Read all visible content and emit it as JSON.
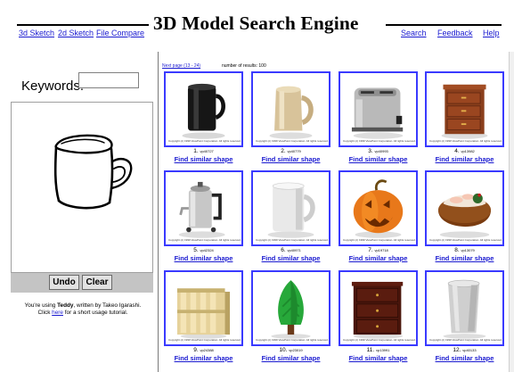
{
  "header": {
    "title": "3D Model Search Engine",
    "left_links": [
      "3d Sketch",
      "2d Sketch",
      "File Compare"
    ],
    "right_links": [
      "Search",
      "Feedback",
      "Help"
    ]
  },
  "search": {
    "keywords_label": "Keywords:",
    "keywords_value": ""
  },
  "sketch": {
    "undo_label": "Undo",
    "clear_label": "Clear",
    "note_prefix": "You're using ",
    "note_app": "Teddy",
    "note_mid": ", written by Takeo Igarashi.",
    "note_click": "Click ",
    "note_here": "here",
    "note_suffix": " for a short usage tutorial."
  },
  "results": {
    "next_page": "Next page (13 - 24)",
    "count_text": "number of results: 100",
    "similar_label": "Find similar shape",
    "copyright": "Copyright (c) 1999 ViewPoint Corporation. All rights reserved.",
    "items": [
      {
        "rank": "1.",
        "id": "vp40727",
        "icon": "black-mug-model"
      },
      {
        "rank": "2.",
        "id": "vp40779",
        "icon": "beige-beer-stein-model"
      },
      {
        "rank": "3.",
        "id": "vp40993",
        "icon": "toaster-model"
      },
      {
        "rank": "4.",
        "id": "vp13982",
        "icon": "wooden-nightstand-model"
      },
      {
        "rank": "5.",
        "id": "vp42324",
        "icon": "coffee-percolator-model"
      },
      {
        "rank": "6.",
        "id": "vp40971",
        "icon": "white-mug-model"
      },
      {
        "rank": "7.",
        "id": "vp19718",
        "icon": "jack-o-lantern-model"
      },
      {
        "rank": "8.",
        "id": "vp13079",
        "icon": "pudding-model"
      },
      {
        "rank": "9.",
        "id": "vp24388",
        "icon": "wooden-crate-model"
      },
      {
        "rank": "10.",
        "id": "vp23019",
        "icon": "green-plant-model"
      },
      {
        "rank": "11.",
        "id": "vp13991",
        "icon": "dark-wood-cabinet-model"
      },
      {
        "rank": "12.",
        "id": "vp40133",
        "icon": "tall-cup-model"
      }
    ]
  },
  "colors": {
    "link": "#1a1ad0",
    "thumb_border": "#3a3aff",
    "button_bar": "#c4c4c4"
  }
}
